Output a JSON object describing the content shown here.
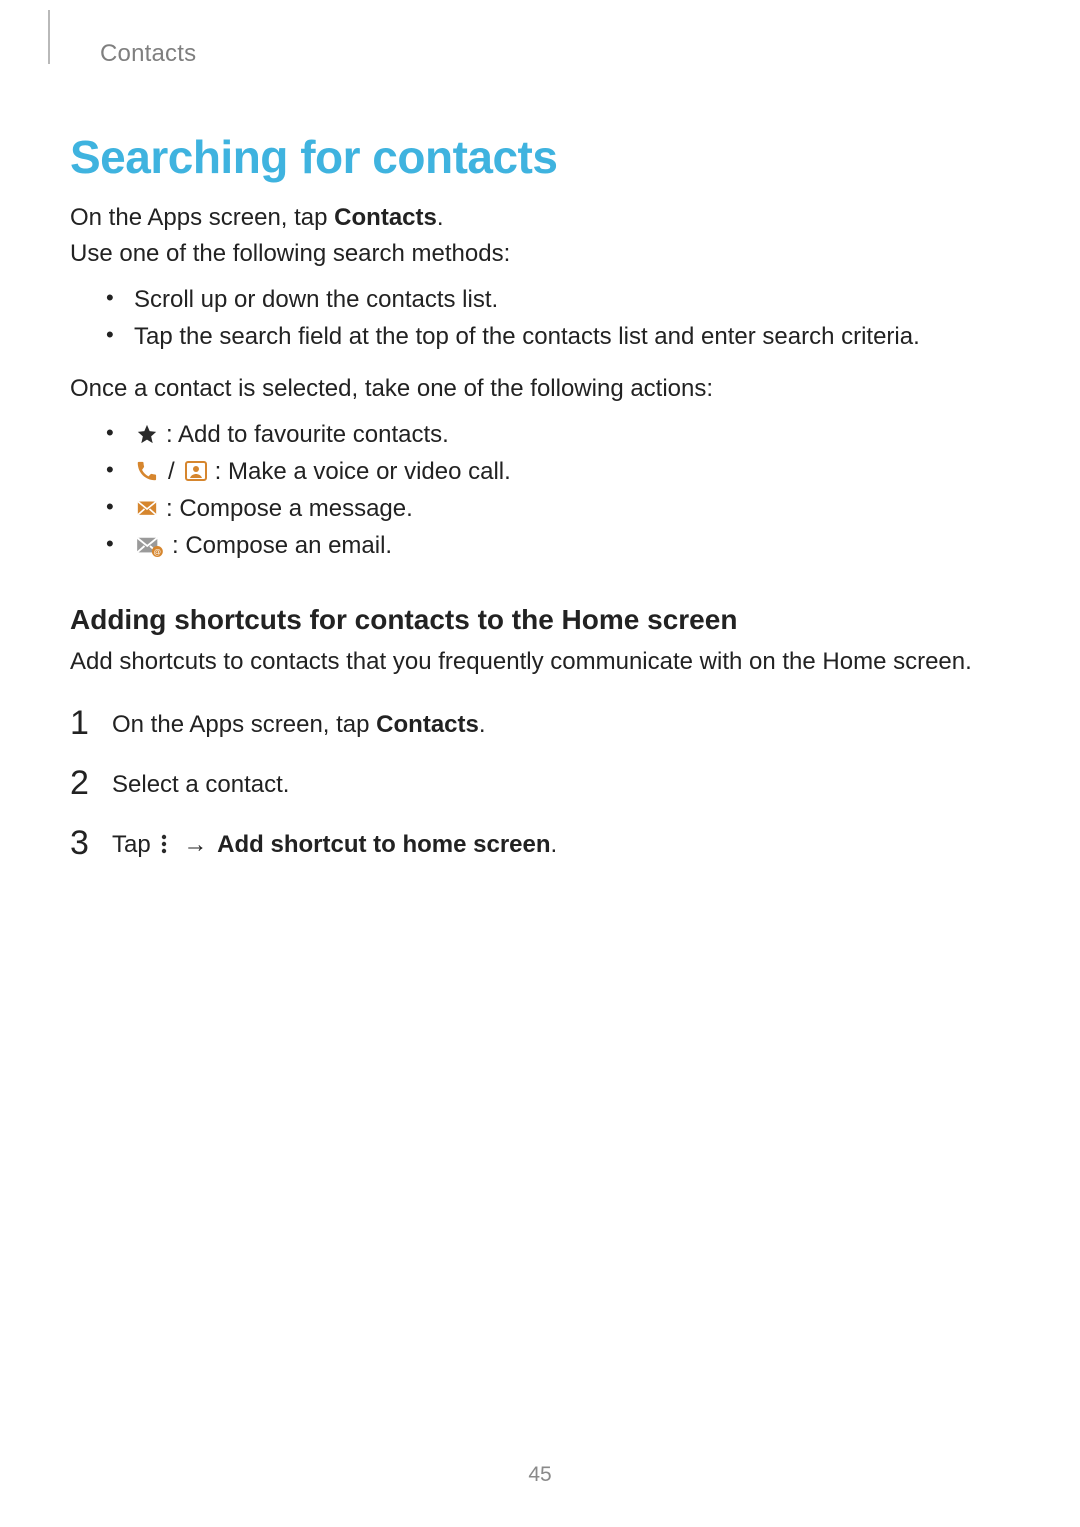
{
  "header": {
    "breadcrumb": "Contacts"
  },
  "title": "Searching for contacts",
  "intro": {
    "line1_pre": "On the Apps screen, tap ",
    "line1_bold": "Contacts",
    "line1_post": ".",
    "line2": "Use one of the following search methods:"
  },
  "search_methods": [
    "Scroll up or down the contacts list.",
    "Tap the search field at the top of the contacts list and enter search criteria."
  ],
  "actions_intro": "Once a contact is selected, take one of the following actions:",
  "actions": {
    "fav": " : Add to favourite contacts.",
    "call": " : Make a voice or video call.",
    "msg": " : Compose a message.",
    "email": " : Compose an email."
  },
  "shortcut": {
    "heading": "Adding shortcuts for contacts to the Home screen",
    "desc": "Add shortcuts to contacts that you frequently communicate with on the Home screen.",
    "step1_pre": "On the Apps screen, tap ",
    "step1_bold": "Contacts",
    "step1_post": ".",
    "step2": "Select a contact.",
    "step3_pre": "Tap ",
    "step3_arrow": "→",
    "step3_bold": " Add shortcut to home screen",
    "step3_post": "."
  },
  "page_number": "45"
}
